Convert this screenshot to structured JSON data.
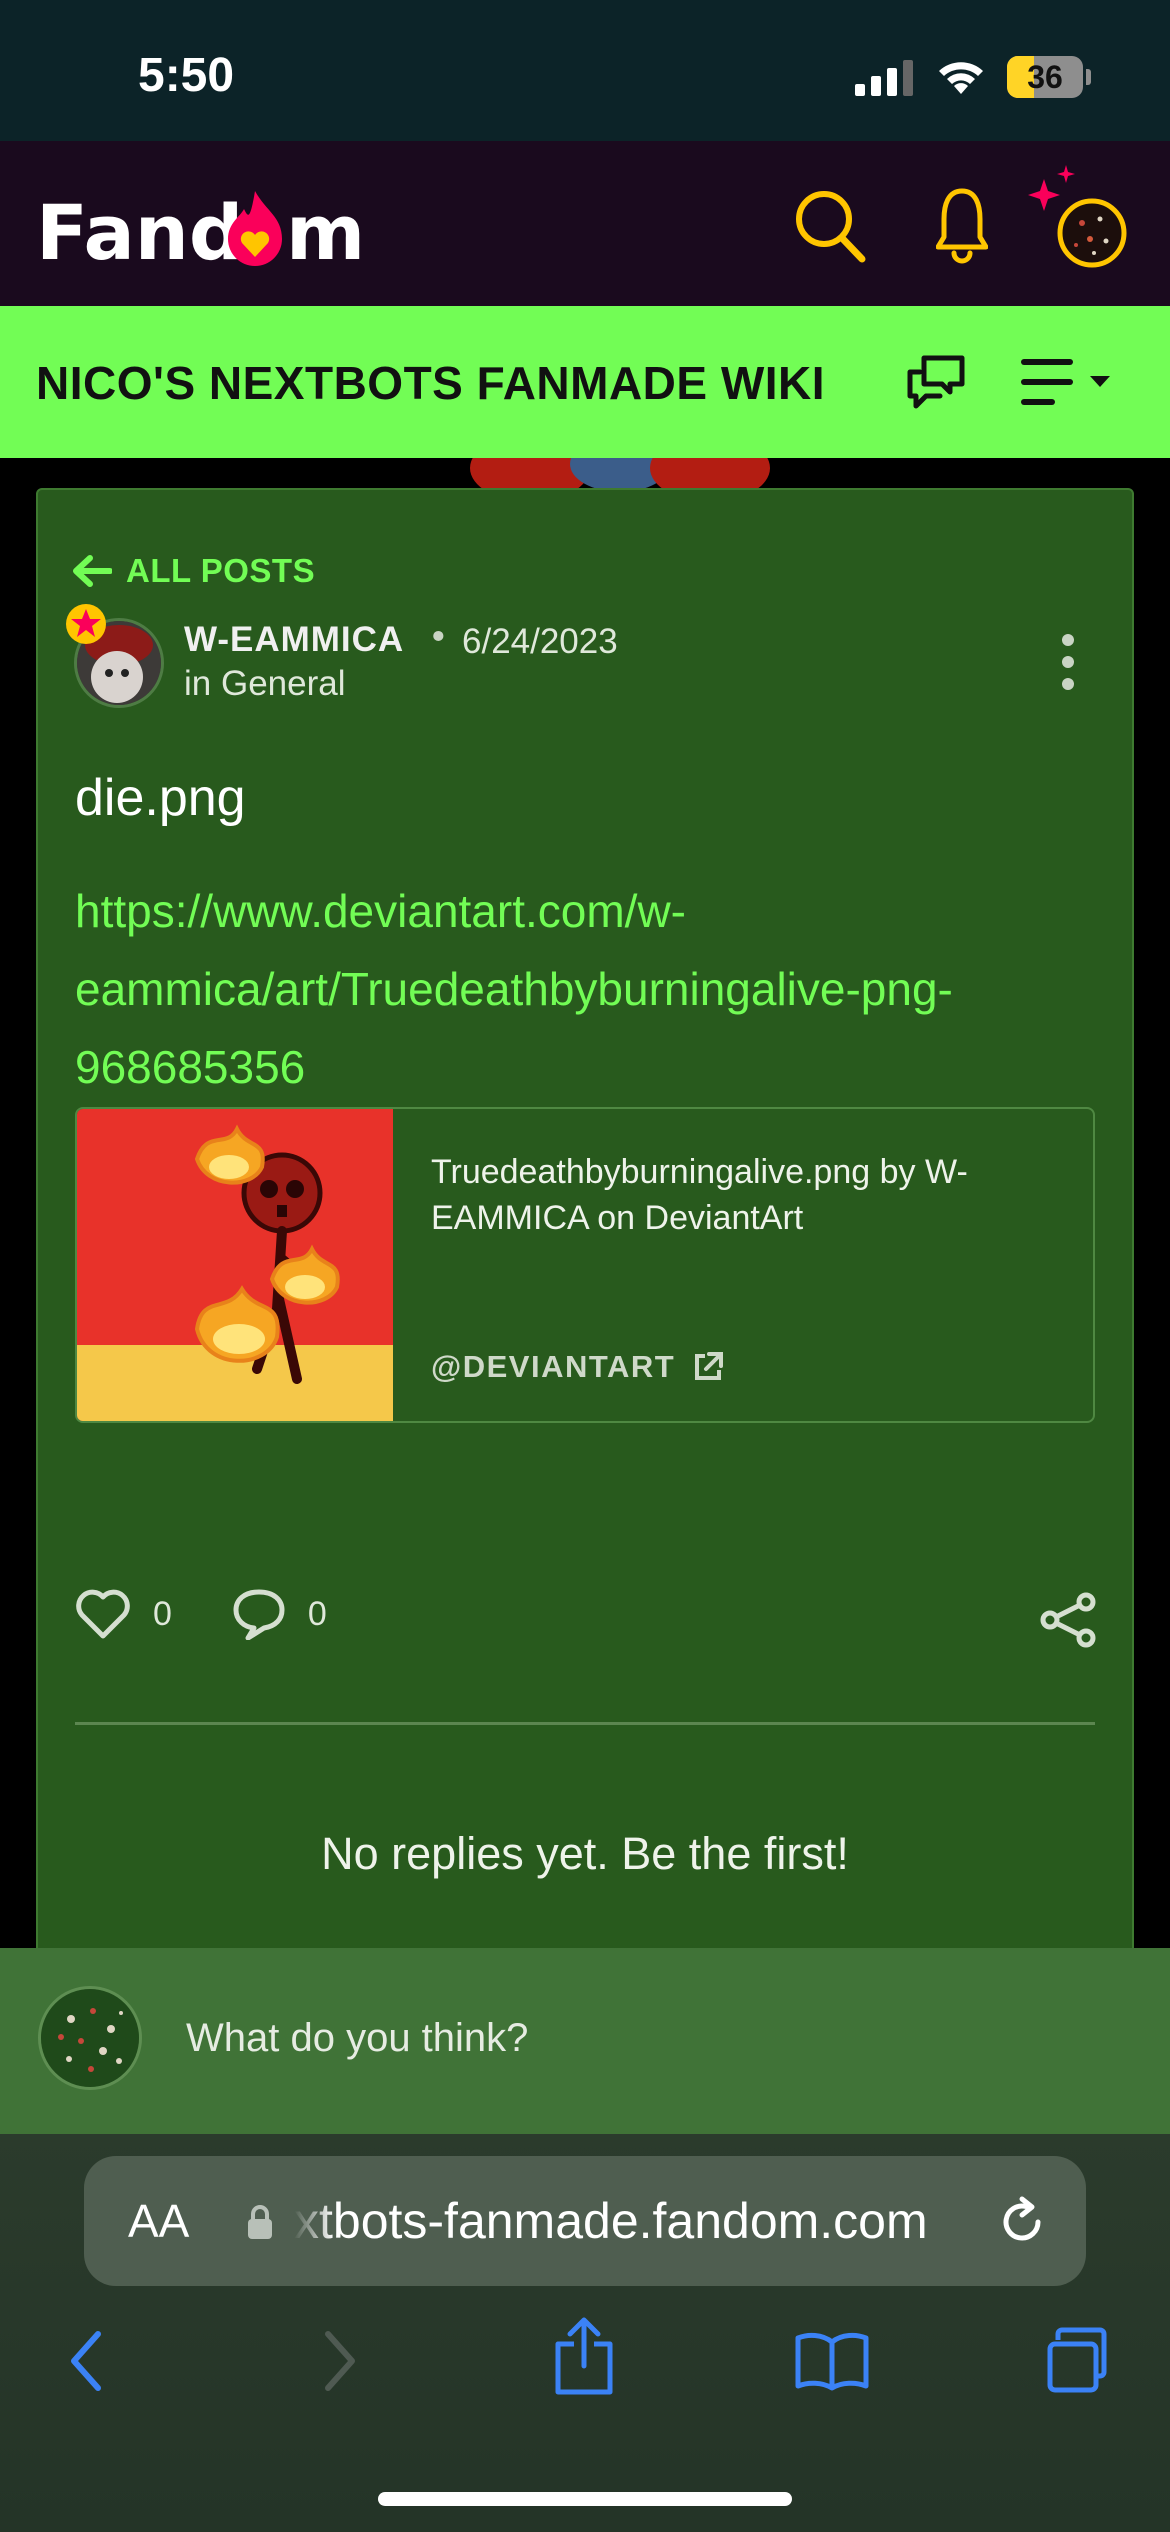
{
  "status_bar": {
    "time": "5:50",
    "battery": {
      "level": 36,
      "label": "36"
    }
  },
  "header": {
    "logo_text": "Fandom",
    "icons": [
      "search-icon",
      "bell-icon",
      "user-avatar-icon"
    ]
  },
  "wiki": {
    "title": "NICO'S NEXTBOTS FANMADE WIKI",
    "icons": [
      "discussions-icon",
      "menu-icon"
    ]
  },
  "post": {
    "back_label": "ALL POSTS",
    "author": "W-EAMMICA",
    "separator": "•",
    "date": "6/24/2023",
    "category": "in General",
    "title": "die.png",
    "link_text": "https://www.deviantart.com/w-eammica/art/Truedeathbyburningalive-png-968685356",
    "preview": {
      "title": "Truedeathbyburningalive.png by W-EAMMICA on DeviantArt",
      "source": "@DEVIANTART"
    },
    "likes": "0",
    "replies": "0",
    "no_replies_text": "No replies yet. Be the first!"
  },
  "reply_box": {
    "placeholder": "What do you think?"
  },
  "browser": {
    "aa_label": "AA",
    "url": "xtbots-fanmade.fandom.com"
  },
  "colors": {
    "accent_green": "#72fd55",
    "card_green": "#285a1d",
    "header_bg": "#1a0a1e",
    "fandom_orange": "#fa005a",
    "icon_yellow": "#ffc500"
  }
}
